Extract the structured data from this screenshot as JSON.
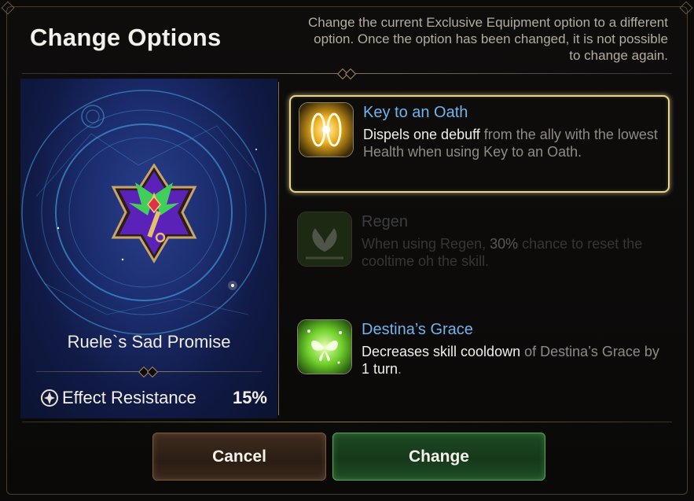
{
  "header": {
    "title": "Change Options",
    "description": "Change the current Exclusive Equipment option to a different option. Once the option has been changed, it is not possible to change again."
  },
  "equipment": {
    "name": "Ruele`s Sad Promise",
    "stat_name": "Effect Resistance",
    "stat_value": "15%",
    "icon": "winged-key-icon"
  },
  "options": [
    {
      "title": "Key to an Oath",
      "state": "selected",
      "icon": "golden-light-rings-icon",
      "text_a": "Dispels one debuff",
      "text_b": " from the ally with the lowest Health when using Key to an Oath."
    },
    {
      "title": "Regen",
      "state": "disabled",
      "icon": "green-leaf-icon",
      "text_a": "When using Regen, ",
      "text_b": "30%",
      "text_c": " chance to reset the cooltime oh the skill."
    },
    {
      "title": "Destina’s Grace",
      "state": "available",
      "icon": "green-butterfly-icon",
      "text_a": "Decreases skill cooldown",
      "text_b": " of Destina’s Grace by ",
      "text_c": "1 turn",
      "text_d": "."
    }
  ],
  "buttons": {
    "cancel": "Cancel",
    "change": "Change"
  },
  "colors": {
    "option_title": "#6fb4ee",
    "selected_border": "#e8d68c",
    "change_button": "#1e4a24",
    "cancel_button": "#3f2c1f"
  }
}
